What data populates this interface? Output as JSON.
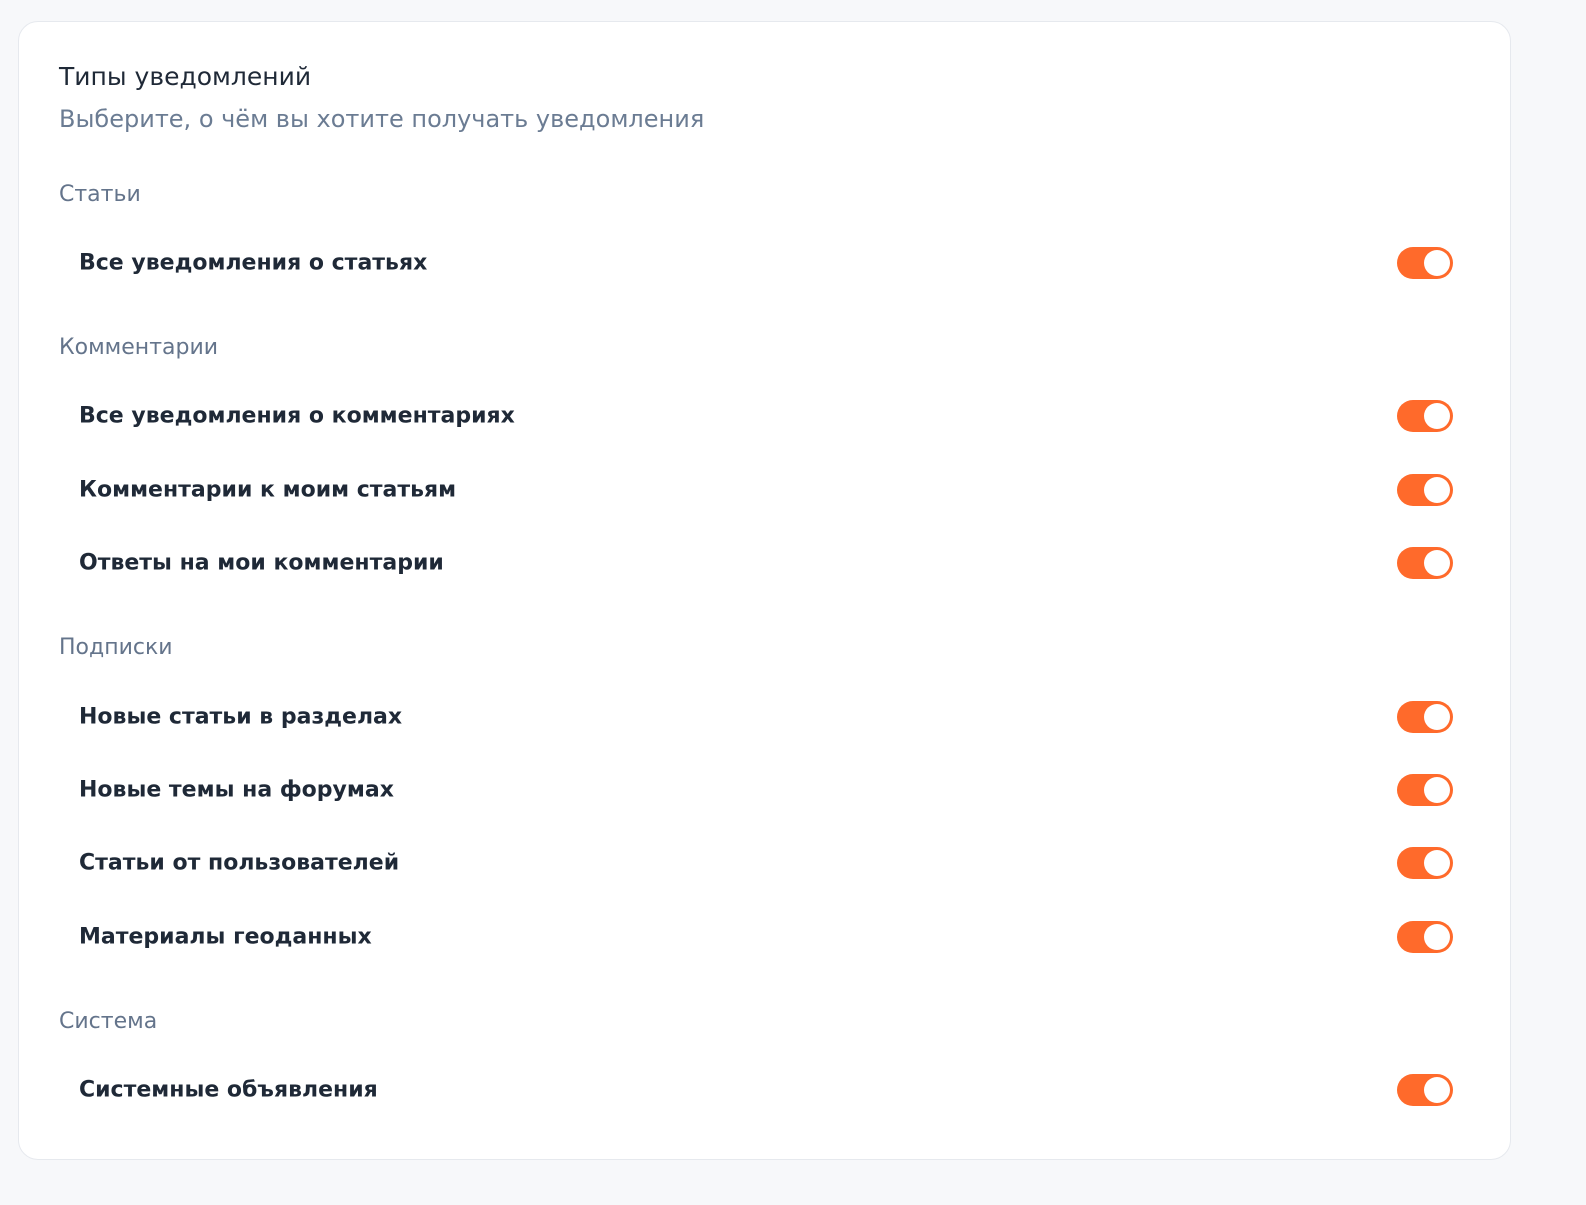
{
  "card": {
    "title": "Типы уведомлений",
    "subtitle": "Выберите, о чём вы хотите получать уведомления"
  },
  "accent_color": "#ff6a2b",
  "sections": [
    {
      "title": "Статьи",
      "items": [
        {
          "label": "Все уведомления о статьях",
          "enabled": true
        }
      ]
    },
    {
      "title": "Комментарии",
      "items": [
        {
          "label": "Все уведомления о комментариях",
          "enabled": true
        },
        {
          "label": "Комментарии к моим статьям",
          "enabled": true
        },
        {
          "label": "Ответы на мои комментарии",
          "enabled": true
        }
      ]
    },
    {
      "title": "Подписки",
      "items": [
        {
          "label": "Новые статьи в разделах",
          "enabled": true
        },
        {
          "label": "Новые темы на форумах",
          "enabled": true
        },
        {
          "label": "Статьи от пользователей",
          "enabled": true
        },
        {
          "label": "Материалы геоданных",
          "enabled": true
        }
      ]
    },
    {
      "title": "Система",
      "items": [
        {
          "label": "Системные объявления",
          "enabled": true
        }
      ]
    }
  ]
}
